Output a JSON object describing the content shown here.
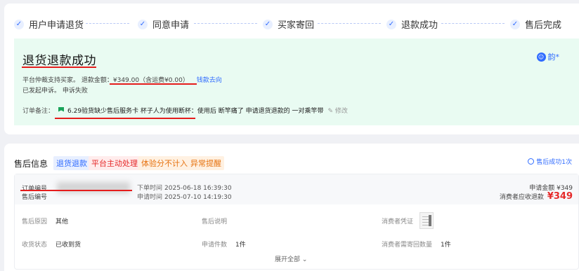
{
  "steps": [
    {
      "label": "用户申请退货"
    },
    {
      "label": "同意申请"
    },
    {
      "label": "买家寄回"
    },
    {
      "label": "退款成功"
    },
    {
      "label": "售后完成"
    }
  ],
  "result": {
    "title": "退货退款成功",
    "line1": "平台仲裁支持买家。  退款金额：¥349.00（含运费¥0.00）",
    "money_link": "钱款去向",
    "line2": "已发起申诉。    申诉失败",
    "note_label": "订单备注：",
    "note_text": "6.29验货缺少售后服务卡 杯子人为使用断杯：使用后 断竿痛了 申请退货退款的 一对乘竿带",
    "edit_label": "修改",
    "user": "韵*"
  },
  "aftersale": {
    "title": "售后信息",
    "tags": [
      "退货退款",
      "平台主动处理",
      "体验分不计入",
      "异常提醒"
    ],
    "status": "售后成功1次",
    "order_no_label": "订单编号",
    "aftersale_no_label": "售后编号",
    "order_time_label": "下单时间",
    "order_time": "2025-06-18 16:39:30",
    "apply_time_label": "申请时间",
    "apply_time": "2025-07-10 14:19:30",
    "apply_amount_label": "申请金额",
    "apply_amount": "¥349",
    "refund_label": "消费者应收退款",
    "refund_amount": "¥349",
    "reason_label": "售后原因",
    "reason": "其他",
    "desc_label": "售后说明",
    "proof_label": "消费者凭证",
    "receive_label": "收货状态",
    "receive": "已收到货",
    "count_label": "申请件数",
    "count": "1件",
    "return_label": "消费者需寄回数量",
    "return_count": "1件",
    "expand": "展开全部"
  }
}
